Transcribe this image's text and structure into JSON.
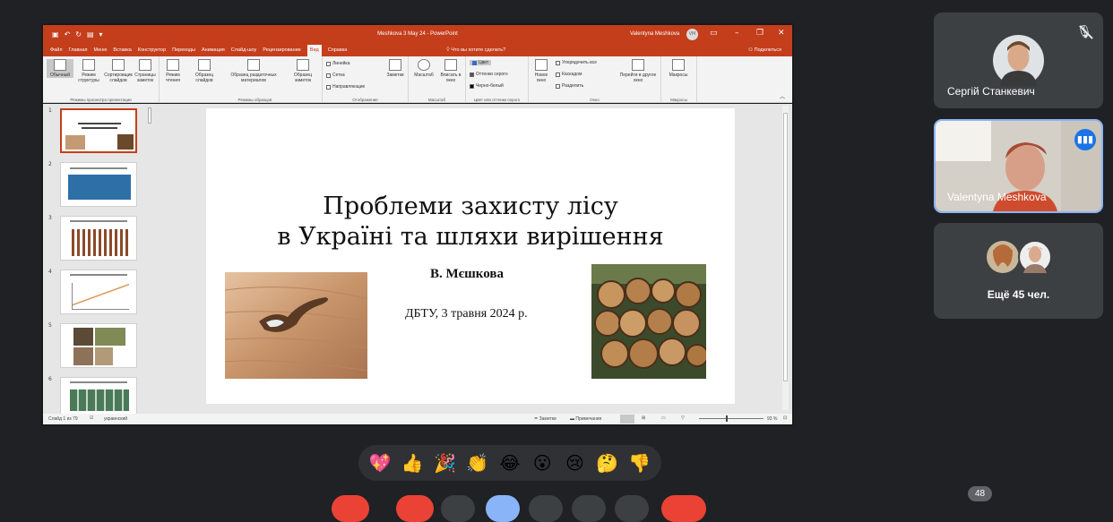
{
  "powerpoint": {
    "title": "Meshkova 3 May 24  -  PowerPoint",
    "user": "Valentyna Meshkova",
    "user_initials": "VM",
    "menu_tabs": [
      "Файл",
      "Главная",
      "Меню",
      "Вставка",
      "Конструктор",
      "Переходы",
      "Анимация",
      "Слайд-шоу",
      "Рецензирование",
      "Вид",
      "Справка"
    ],
    "active_tab": "Вид",
    "tell_me": "Что вы хотите сделать?",
    "share": "Поделиться",
    "ribbon": {
      "view_modes": [
        "Обычный",
        "Режим структуры",
        "Сортировщик слайдов",
        "Страницы заметок",
        "Режим чтения"
      ],
      "view_modes_label": "Режимы просмотра презентации",
      "masters": [
        "Образец слайдов",
        "Образец раздаточных материалов",
        "Образец заметок"
      ],
      "masters_label": "Режимы образцов",
      "show": [
        "Линейка",
        "Сетка",
        "Направляющие"
      ],
      "notes": "Заметки",
      "show_label": "Отображение",
      "zoom": [
        "Масштаб",
        "Вписать в окно"
      ],
      "zoom_label": "Масштаб",
      "color": [
        "Цвет",
        "Оттенки серого",
        "Черно-белый"
      ],
      "color_label": "Цвет или оттенки серого",
      "window": [
        "Новое окно",
        "Упорядочить все",
        "Каскадом",
        "Разделить",
        "Перейти в другое окно"
      ],
      "window_label": "Окно",
      "macros": "Макросы",
      "macros_label": "Макросы"
    },
    "thumb_numbers": [
      "1",
      "2",
      "3",
      "4",
      "5",
      "6"
    ],
    "slide": {
      "title_line1": "Проблеми захисту лісу",
      "title_line2": "в Україні та шляхи вирішення",
      "author": "В. Мєшкова",
      "date": "ДБТУ, 3 травня 2024 р."
    },
    "status": {
      "slide_counter": "Слайд 1 из 79",
      "language": "украинский",
      "notes": "Заметки",
      "comments": "Примечания",
      "zoom": "93 %"
    }
  },
  "participants": [
    {
      "name": "Сергій Станкевич",
      "muted": true
    },
    {
      "name": "Valentyna Meshkova",
      "speaking": true
    },
    {
      "name": "Ещё 45 чел."
    }
  ],
  "reactions": [
    "💖",
    "👍",
    "🎉",
    "👏",
    "😂",
    "😮",
    "😢",
    "🤔",
    "👎"
  ],
  "participant_count": "48",
  "colors": {
    "ppt_accent": "#c43e1c",
    "meet_bg": "#202124",
    "tile_bg": "#3c4043",
    "speaking_border": "#8ab4f8",
    "end_call": "#ea4335"
  }
}
